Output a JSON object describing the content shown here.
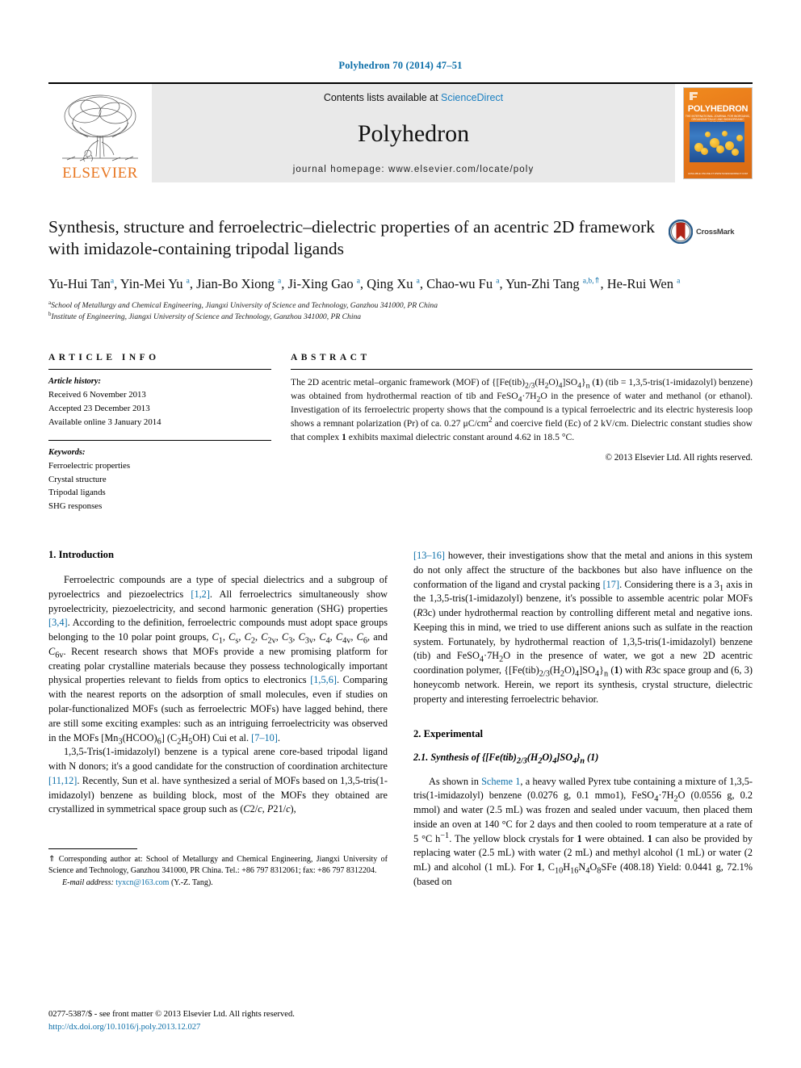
{
  "running_head": "Polyhedron 70 (2014) 47–51",
  "masthead": {
    "publisher": "ELSEVIER",
    "contents_prefix": "Contents lists available at ",
    "contents_link": "ScienceDirect",
    "journal_name": "Polyhedron",
    "homepage": "journal homepage: www.elsevier.com/locate/poly",
    "cover_title": "POLYHEDRON",
    "cover_subtitle": "THE INTERNATIONAL JOURNAL FOR INORGANIC, ORGANOMETALLIC AND BIOINORGANIC CHEMISTRY",
    "cover_footer": "AVAILABLE ONLINE AT WWW.SCIENCEDIRECT.COM"
  },
  "article": {
    "title": "Synthesis, structure and ferroelectric–dielectric properties of an acentric 2D framework with imidazole-containing tripodal ligands",
    "crossmark_label": "CrossMark",
    "authors_html": "Yu-Hui Tan<sup>a</sup>, Yin-Mei Yu <sup>a</sup>, Jian-Bo Xiong <sup>a</sup>, Ji-Xing Gao <sup>a</sup>, Qing Xu <sup>a</sup>, Chao-wu Fu <sup>a</sup>, Yun-Zhi Tang <sup>a,b,</sup><sup>⇑</sup>, He-Rui Wen <sup>a</sup>",
    "affiliations": [
      {
        "marker": "a",
        "text": "School of Metallurgy and Chemical Engineering, Jiangxi University of Science and Technology, Ganzhou 341000, PR China"
      },
      {
        "marker": "b",
        "text": "Institute of Engineering, Jiangxi University of Science and Technology, Ganzhou 341000, PR China"
      }
    ]
  },
  "article_info": {
    "heading": "ARTICLE INFO",
    "history_label": "Article history:",
    "history": [
      "Received 6 November 2013",
      "Accepted 23 December 2013",
      "Available online 3 January 2014"
    ],
    "keywords_label": "Keywords:",
    "keywords": [
      "Ferroelectric properties",
      "Crystal structure",
      "Tripodal ligands",
      "SHG responses"
    ]
  },
  "abstract": {
    "heading": "ABSTRACT",
    "body_html": "The 2D acentric metal–organic framework (MOF) of {[Fe(tib)<sub>2/3</sub>(H<sub>2</sub>O)<sub>4</sub>]SO<sub>4</sub>}<sub>n</sub> (<b>1</b>) (tib = 1,3,5-tris(1-imidazolyl) benzene) was obtained from hydrothermal reaction of tib and FeSO<sub>4</sub>·7H<sub>2</sub>O in the presence of water and methanol (or ethanol). Investigation of its ferroelectric property shows that the compound is a typical ferroelectric and its electric hysteresis loop shows a remnant polarization (Pr) of ca. 0.27 μC/cm<sup>2</sup> and coercive field (Ec) of 2 kV/cm. Dielectric constant studies show that complex <b>1</b> exhibits maximal dielectric constant around 4.62 in 18.5 °C.",
    "copyright": "© 2013 Elsevier Ltd. All rights reserved."
  },
  "sections": {
    "introduction_heading": "1. Introduction",
    "intro_p1_html": "Ferroelectric compounds are a type of special dielectrics and a subgroup of pyroelectrics and piezoelectrics <span class=\"ref\">[1,2]</span>. All ferroelectrics simultaneously show pyroelectricity, piezoelectricity, and second harmonic generation (SHG) properties <span class=\"ref\">[3,4]</span>. According to the definition, ferroelectric compounds must adopt space groups belonging to the 10 polar point groups, <i>C</i><sub>1</sub>, <i>C</i><sub>s</sub>, <i>C</i><sub>2</sub>, <i>C</i><sub>2v</sub>, <i>C</i><sub>3</sub>, <i>C</i><sub>3v</sub>, <i>C</i><sub>4</sub>, <i>C</i><sub>4v</sub>, <i>C</i><sub>6</sub>, and <i>C</i><sub>6v</sub>. Recent research shows that MOFs provide a new promising platform for creating polar crystalline materials because they possess technologically important physical properties relevant to fields from optics to electronics <span class=\"ref\">[1,5,6]</span>. Comparing with the nearest reports on the adsorption of small molecules, even if studies on polar-functionalized MOFs (such as ferroelectric MOFs) have lagged behind, there are still some exciting examples: such as an intriguing ferroelectricity was observed in the MOFs [Mn<sub>3</sub>(HCOO)<sub>6</sub>] (C<sub>2</sub>H<sub>5</sub>OH) Cui et al. <span class=\"ref\">[7–10]</span>.",
    "intro_p2_html": "1,3,5-Tris(1-imidazolyl) benzene is a typical arene core-based tripodal ligand with N donors; it's a good candidate for the construction of coordination architecture <span class=\"ref\">[11,12]</span>. Recently, Sun et al. have synthesized a serial of MOFs based on 1,3,5-tris(1-imidazolyl) benzene as building block, most of the MOFs they obtained are crystallized in symmetrical space group such as (<i>C</i>2/<i>c</i>, <i>P</i>21/<i>c</i>),",
    "intro_p3_html": "<span class=\"ref\">[13–16]</span> however, their investigations show that the metal and anions in this system do not only affect the structure of the backbones but also have influence on the conformation of the ligand and crystal packing <span class=\"ref\">[17]</span>. Considering there is a 3<sub>1</sub> axis in the 1,3,5-tris(1-imidazolyl) benzene, it's possible to assemble acentric polar MOFs (<i>R</i>3c) under hydrothermal reaction by controlling different metal and negative ions. Keeping this in mind, we tried to use different anions such as sulfate in the reaction system. Fortunately, by hydrothermal reaction of 1,3,5-tris(1-imidazolyl) benzene (tib) and FeSO<sub>4</sub>·7H<sub>2</sub>O in the presence of water, we got a new 2D acentric coordination polymer, {[Fe(tib)<sub>2/3</sub>(H<sub>2</sub>O)<sub>4</sub>]SO<sub>4</sub>}<sub>n</sub> (<b>1</b>) with <i>R</i>3c space group and (6, 3) honeycomb network. Herein, we report its synthesis, crystal structure, dielectric property and interesting ferroelectric behavior.",
    "experimental_heading": "2. Experimental",
    "subsec_2_1_html": "2.1. Synthesis of {[Fe(tib)<sub>2/3</sub>(H<sub>2</sub>O)<sub>4</sub>]SO<sub>4</sub>}<sub>n</sub> (<b>1</b>)",
    "exp_p1_html": "As shown in <span class=\"link\">Scheme 1</span>, a heavy walled Pyrex tube containing a mixture of 1,3,5-tris(1-imidazolyl) benzene (0.0276 g, 0.1 mmo1), FeSO<sub>4</sub>·7H<sub>2</sub>O (0.0556 g, 0.2 mmol) and water (2.5 mL) was frozen and sealed under vacuum, then placed them inside an oven at 140 °C for 2 days and then cooled to room temperature at a rate of 5 °C h<sup>−1</sup>. The yellow block crystals for <b>1</b> were obtained. <b>1</b> can also be provided by replacing water (2.5 mL) with water (2 mL) and methyl alcohol (1 mL) or water (2 mL) and alcohol (1 mL). For <b>1</b>, C<sub>10</sub>H<sub>16</sub>N<sub>4</sub>O<sub>8</sub>SFe (408.18) Yield: 0.0441 g, 72.1% (based on"
  },
  "footnote": {
    "corresponding_html": "⇑ Corresponding author at: School of Metallurgy and Chemical Engineering, Jiangxi University of Science and Technology, Ganzhou 341000, PR China. Tel.: +86 797 8312061; fax: +86 797 8312204.",
    "email_label": "E-mail address:",
    "email": "tyxcn@163.com",
    "email_suffix": "(Y.-Z. Tang)."
  },
  "page_footer": {
    "issn_line": "0277-5387/$ - see front matter © 2013 Elsevier Ltd. All rights reserved.",
    "doi": "http://dx.doi.org/10.1016/j.poly.2013.12.027"
  },
  "colors": {
    "link_blue": "#0b6ea8",
    "elsevier_orange": "#E87722",
    "masthead_gray": "#e9e9e9"
  }
}
